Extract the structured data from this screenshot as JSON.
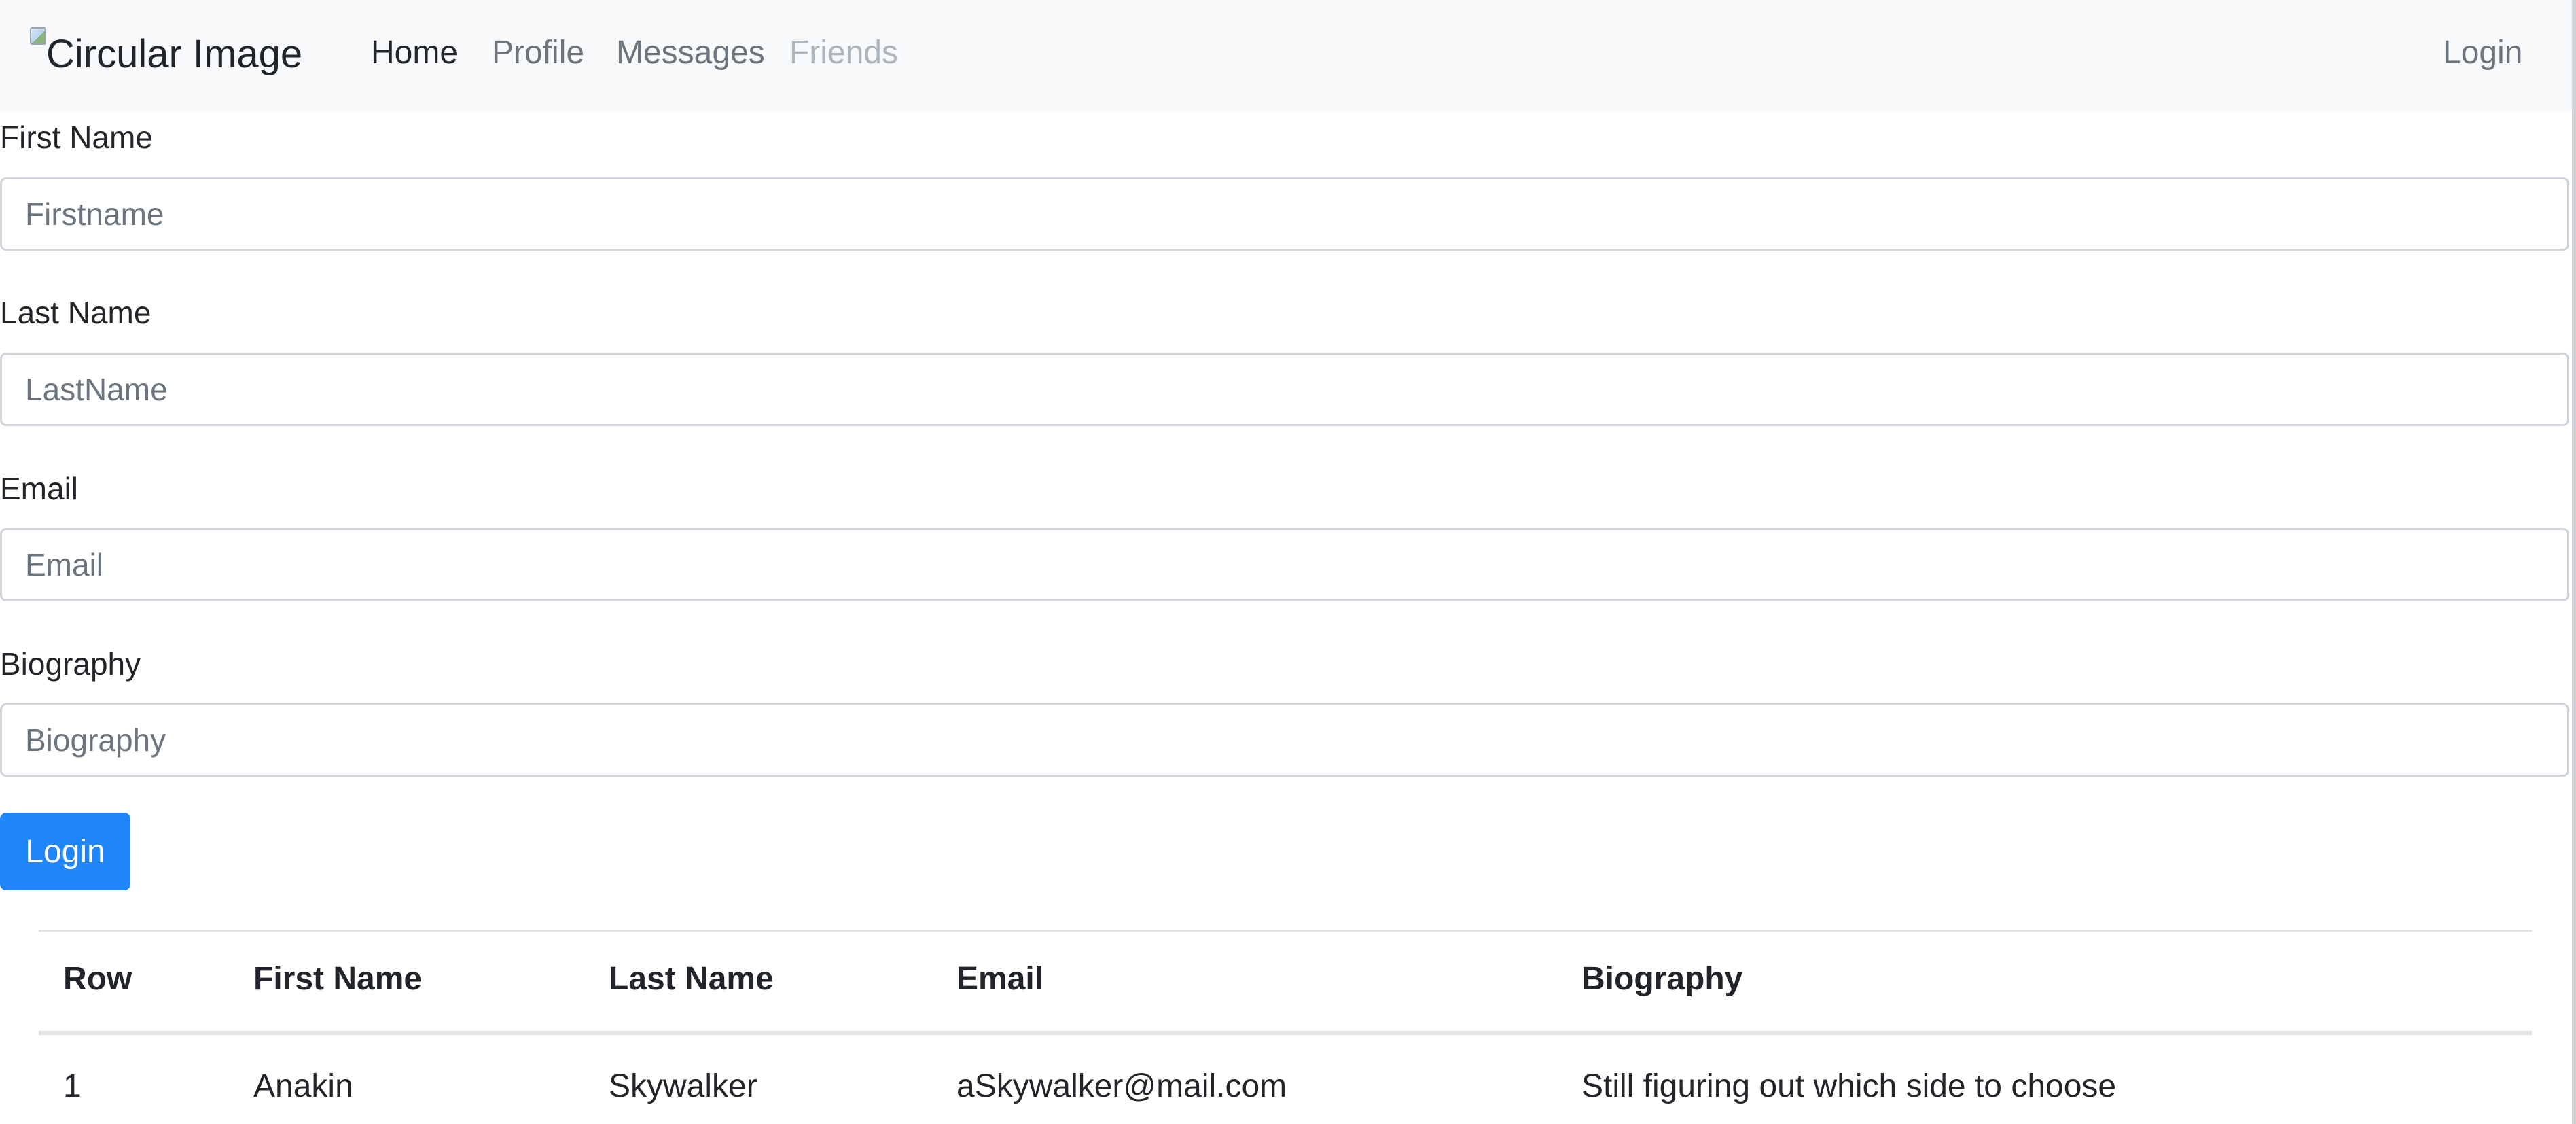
{
  "navbar": {
    "brand_alt": "Circular Image",
    "links": [
      {
        "label": "Home",
        "state": "active"
      },
      {
        "label": "Profile",
        "state": "normal"
      },
      {
        "label": "Messages",
        "state": "normal"
      },
      {
        "label": "Friends",
        "state": "disabled"
      }
    ],
    "login_label": "Login"
  },
  "form": {
    "first_name": {
      "label": "First Name",
      "placeholder": "Firstname",
      "value": ""
    },
    "last_name": {
      "label": "Last Name",
      "placeholder": "LastName",
      "value": ""
    },
    "email": {
      "label": "Email",
      "placeholder": "Email",
      "value": ""
    },
    "biography": {
      "label": "Biography",
      "placeholder": "Biography",
      "value": ""
    },
    "submit_label": "Login"
  },
  "table": {
    "headers": [
      "Row",
      "First Name",
      "Last Name",
      "Email",
      "Biography"
    ],
    "rows": [
      [
        "1",
        "Anakin",
        "Skywalker",
        "aSkywalker@mail.com",
        "Still figuring out which side to choose"
      ]
    ]
  },
  "colors": {
    "primary": "#1f86fb",
    "navbar_bg": "#f8f9fa",
    "muted_text": "#6c757d",
    "disabled_text": "#adb5bd"
  }
}
